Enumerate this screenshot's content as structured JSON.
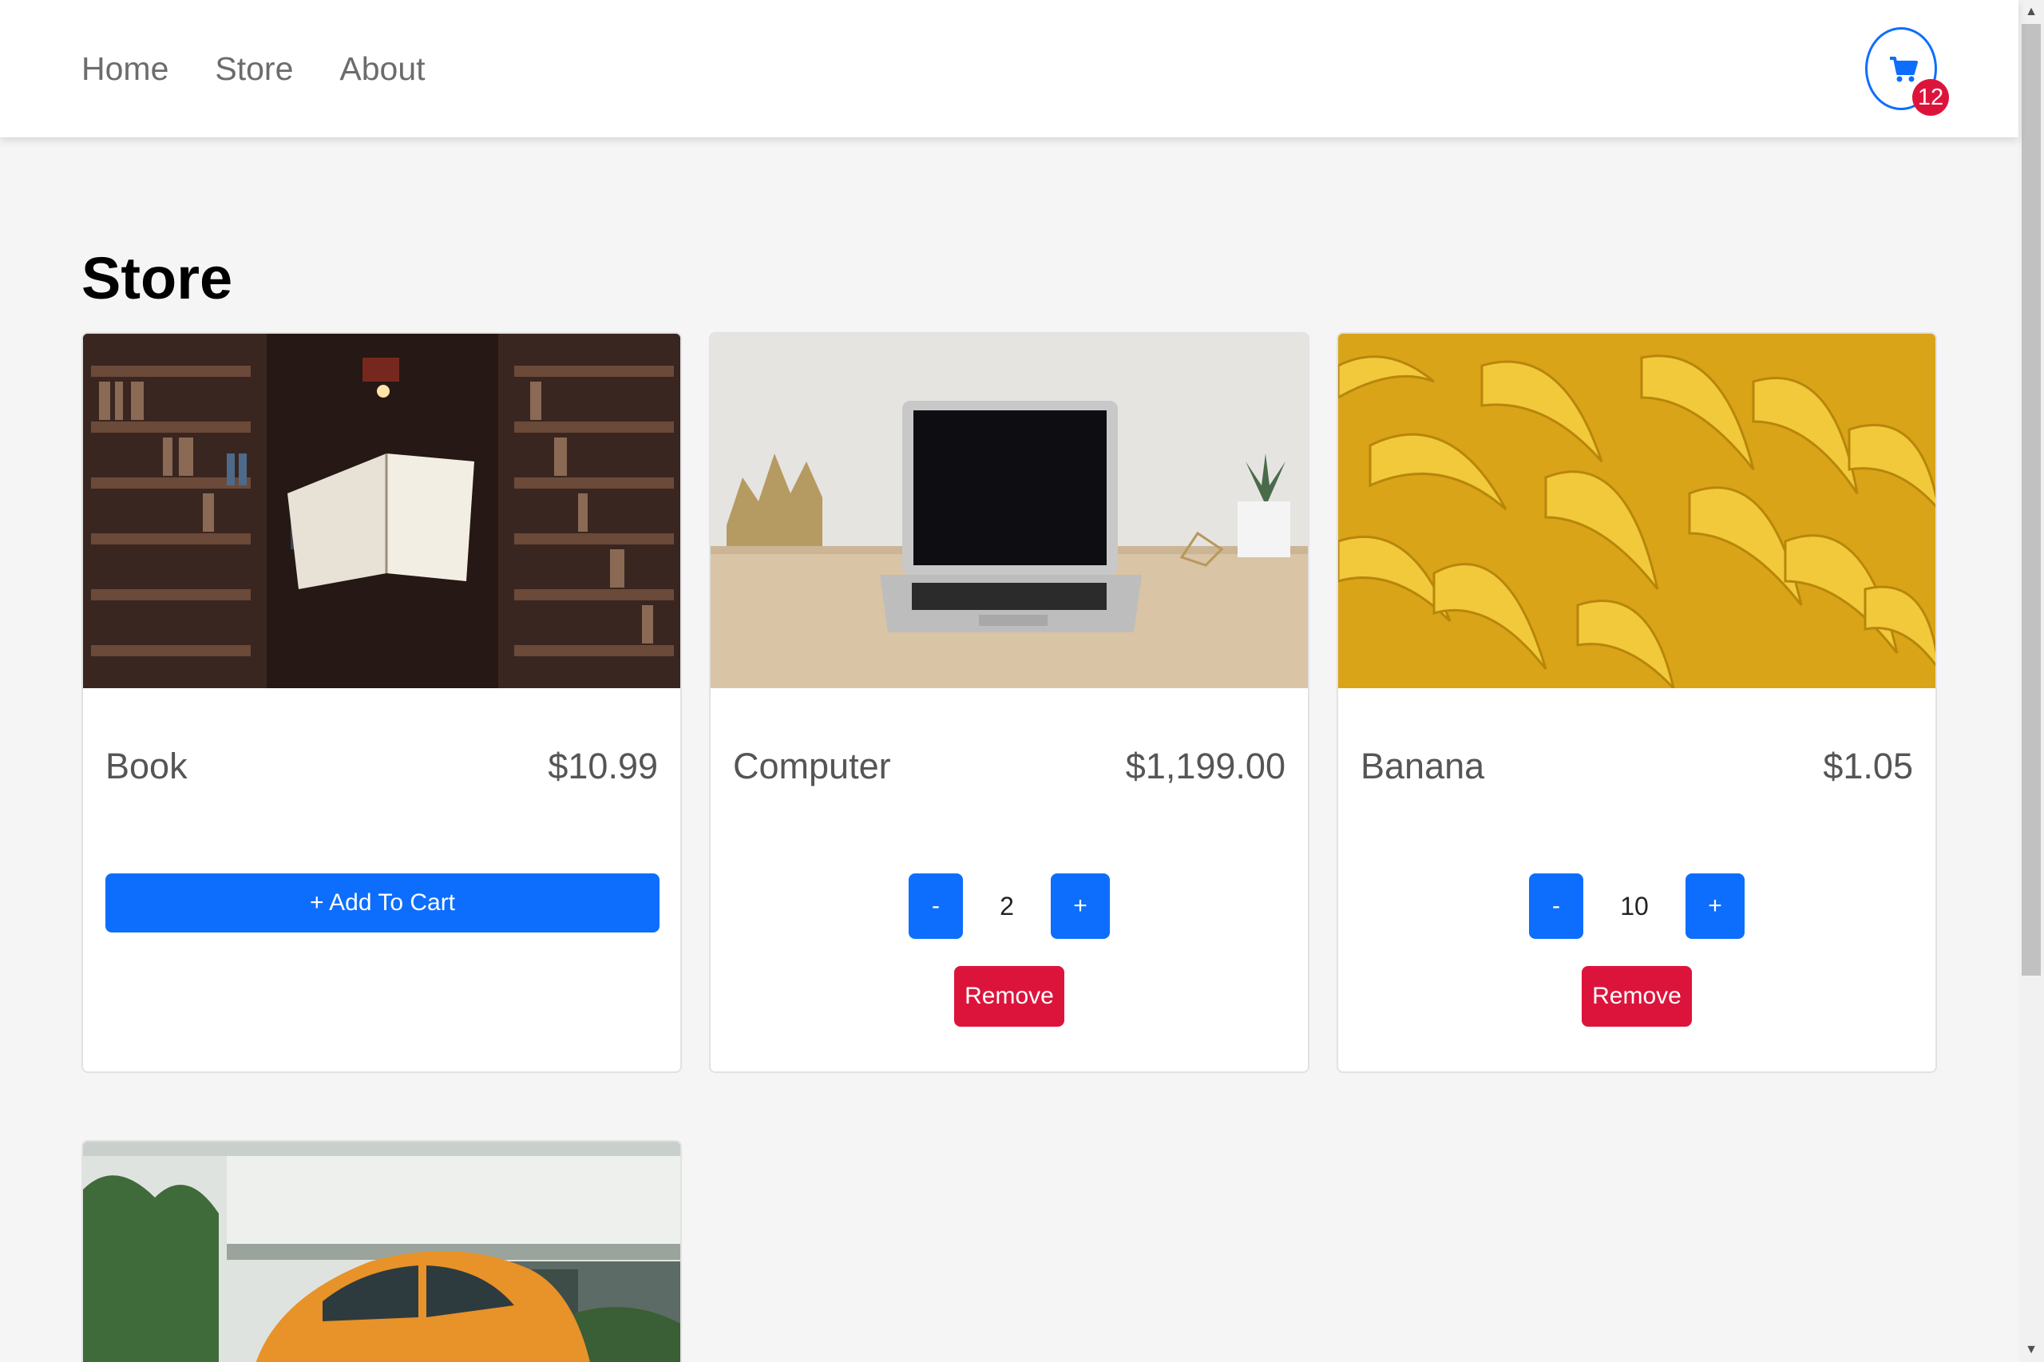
{
  "nav": {
    "links": [
      "Home",
      "Store",
      "About"
    ],
    "cart_count": "12",
    "cart_icon": "shopping-cart-icon"
  },
  "page": {
    "title": "Store"
  },
  "products": [
    {
      "name": "Book",
      "price": "$10.99",
      "action": "+ Add To Cart"
    },
    {
      "name": "Computer",
      "price": "$1,199.00",
      "quantity": "2",
      "decrement": "-",
      "increment": "+",
      "remove": "Remove"
    },
    {
      "name": "Banana",
      "price": "$1.05",
      "quantity": "10",
      "decrement": "-",
      "increment": "+",
      "remove": "Remove"
    }
  ],
  "colors": {
    "primary": "#0d6efd",
    "danger": "#dc143c",
    "background": "#f5f5f5"
  }
}
